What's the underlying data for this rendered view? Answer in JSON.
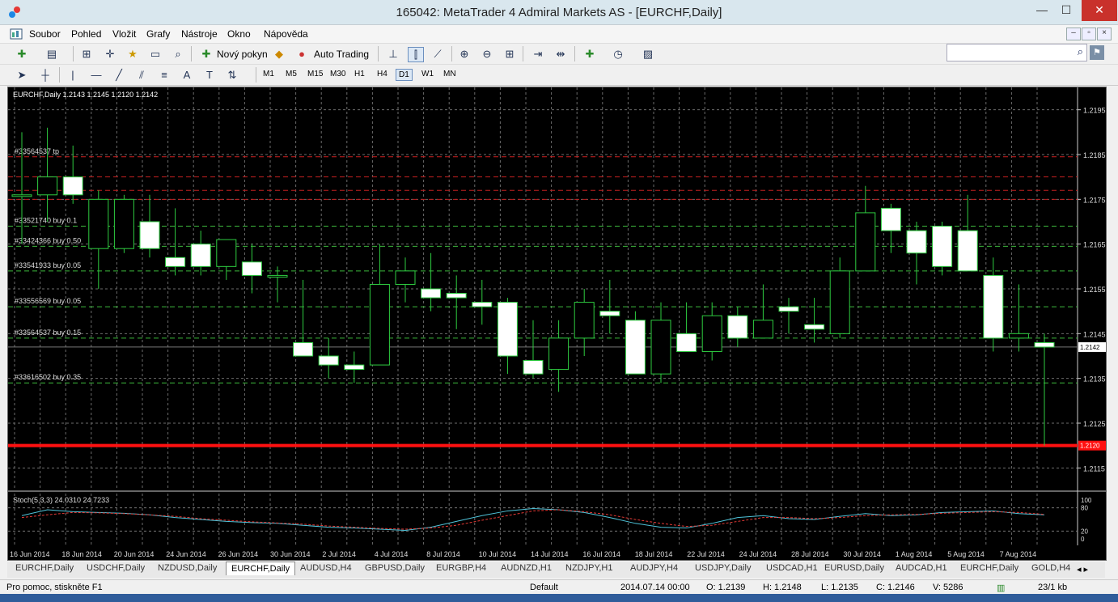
{
  "window": {
    "title": "165042: MetaTrader 4 Admiral Markets AS - [EURCHF,Daily]",
    "min_glyph": "—",
    "max_glyph": "☐",
    "close_glyph": "✕"
  },
  "menu": [
    "Soubor",
    "Pohled",
    "Vložit",
    "Grafy",
    "Nástroje",
    "Okno",
    "Nápověda"
  ],
  "toolbar": {
    "new_order_label": "Nový pokyn",
    "auto_trading_label": "Auto Trading"
  },
  "timeframes": [
    "M1",
    "M5",
    "M15",
    "M30",
    "H1",
    "H4",
    "D1",
    "W1",
    "MN"
  ],
  "active_timeframe": "D1",
  "chart": {
    "header": "EURCHF,Daily  1.2143 1.2145 1.2120 1.2142",
    "price_labels": [
      "1.2195",
      "1.2185",
      "1.2175",
      "1.2165",
      "1.2155",
      "1.2145",
      "1.2135",
      "1.2125",
      "1.2115"
    ],
    "current_price": "1.2142",
    "alert_price": "1.2120",
    "orders": [
      {
        "label": "#33564537 tp",
        "price": 1.21845,
        "color": "#d02020"
      },
      {
        "label": "#33521740 buy 0.1",
        "price": 1.2169,
        "color": "#3db83d"
      },
      {
        "label": "#33424366 buy 0.50",
        "price": 1.21645,
        "color": "#3db83d"
      },
      {
        "label": "#33541933 buy 0.05",
        "price": 1.2159,
        "color": "#3db83d"
      },
      {
        "label": "#33556569 buy 0.05",
        "price": 1.2151,
        "color": "#3db83d"
      },
      {
        "label": "#33564537 buy 0.15",
        "price": 1.2144,
        "color": "#3db83d"
      },
      {
        "label": "#33616502 buy 0.35",
        "price": 1.2134,
        "color": "#3db83d"
      }
    ],
    "stoch_header": "Stoch(5,3,3) 24.0310 24.7233",
    "stoch_levels": [
      "100",
      "80",
      "20",
      "0"
    ],
    "dates": [
      "16 Jun 2014",
      "18 Jun 2014",
      "20 Jun 2014",
      "24 Jun 2014",
      "26 Jun 2014",
      "30 Jun 2014",
      "2 Jul 2014",
      "4 Jul 2014",
      "8 Jul 2014",
      "10 Jul 2014",
      "14 Jul 2014",
      "16 Jul 2014",
      "18 Jul 2014",
      "22 Jul 2014",
      "24 Jul 2014",
      "28 Jul 2014",
      "30 Jul 2014",
      "1 Aug 2014",
      "5 Aug 2014",
      "7 Aug 2014"
    ]
  },
  "chart_data": {
    "type": "candlestick",
    "title": "EURCHF,Daily",
    "ylim": [
      1.211,
      1.22
    ],
    "candles": [
      {
        "o": 1.2176,
        "h": 1.219,
        "l": 1.2165,
        "c": 1.2176
      },
      {
        "o": 1.2176,
        "h": 1.2191,
        "l": 1.217,
        "c": 1.218
      },
      {
        "o": 1.218,
        "h": 1.2187,
        "l": 1.2174,
        "c": 1.2176
      },
      {
        "o": 1.2164,
        "h": 1.2177,
        "l": 1.2155,
        "c": 1.2175
      },
      {
        "o": 1.2164,
        "h": 1.2176,
        "l": 1.2163,
        "c": 1.2175
      },
      {
        "o": 1.217,
        "h": 1.2176,
        "l": 1.2162,
        "c": 1.2164
      },
      {
        "o": 1.2162,
        "h": 1.2173,
        "l": 1.2158,
        "c": 1.216
      },
      {
        "o": 1.2165,
        "h": 1.2168,
        "l": 1.2158,
        "c": 1.216
      },
      {
        "o": 1.216,
        "h": 1.2166,
        "l": 1.2157,
        "c": 1.2166
      },
      {
        "o": 1.2161,
        "h": 1.2165,
        "l": 1.2154,
        "c": 1.2158
      },
      {
        "o": 1.2158,
        "h": 1.216,
        "l": 1.2152,
        "c": 1.2158
      },
      {
        "o": 1.2143,
        "h": 1.2157,
        "l": 1.214,
        "c": 1.214
      },
      {
        "o": 1.214,
        "h": 1.2144,
        "l": 1.2135,
        "c": 1.2138
      },
      {
        "o": 1.2138,
        "h": 1.2141,
        "l": 1.2134,
        "c": 1.2137
      },
      {
        "o": 1.2138,
        "h": 1.2165,
        "l": 1.2138,
        "c": 1.2156
      },
      {
        "o": 1.2156,
        "h": 1.2162,
        "l": 1.2152,
        "c": 1.2159
      },
      {
        "o": 1.2155,
        "h": 1.2163,
        "l": 1.215,
        "c": 1.2153
      },
      {
        "o": 1.2154,
        "h": 1.2158,
        "l": 1.2146,
        "c": 1.2153
      },
      {
        "o": 1.2152,
        "h": 1.2157,
        "l": 1.2147,
        "c": 1.2151
      },
      {
        "o": 1.2152,
        "h": 1.2153,
        "l": 1.2136,
        "c": 1.214
      },
      {
        "o": 1.2139,
        "h": 1.2148,
        "l": 1.2135,
        "c": 1.2136
      },
      {
        "o": 1.2137,
        "h": 1.2148,
        "l": 1.2132,
        "c": 1.2144
      },
      {
        "o": 1.2144,
        "h": 1.2155,
        "l": 1.214,
        "c": 1.2152
      },
      {
        "o": 1.215,
        "h": 1.2157,
        "l": 1.2145,
        "c": 1.2149
      },
      {
        "o": 1.2148,
        "h": 1.215,
        "l": 1.2136,
        "c": 1.2136
      },
      {
        "o": 1.2136,
        "h": 1.2152,
        "l": 1.2134,
        "c": 1.2148
      },
      {
        "o": 1.2145,
        "h": 1.2152,
        "l": 1.2141,
        "c": 1.2141
      },
      {
        "o": 1.2141,
        "h": 1.2152,
        "l": 1.2139,
        "c": 1.2149
      },
      {
        "o": 1.2149,
        "h": 1.2151,
        "l": 1.2142,
        "c": 1.2144
      },
      {
        "o": 1.2144,
        "h": 1.2156,
        "l": 1.2144,
        "c": 1.2148
      },
      {
        "o": 1.2151,
        "h": 1.2153,
        "l": 1.2145,
        "c": 1.215
      },
      {
        "o": 1.2147,
        "h": 1.2153,
        "l": 1.2143,
        "c": 1.2146
      },
      {
        "o": 1.2145,
        "h": 1.2162,
        "l": 1.2144,
        "c": 1.2159
      },
      {
        "o": 1.2159,
        "h": 1.2178,
        "l": 1.2159,
        "c": 1.2172
      },
      {
        "o": 1.2173,
        "h": 1.2174,
        "l": 1.2163,
        "c": 1.2168
      },
      {
        "o": 1.2168,
        "h": 1.217,
        "l": 1.2156,
        "c": 1.2163
      },
      {
        "o": 1.2169,
        "h": 1.217,
        "l": 1.2158,
        "c": 1.216
      },
      {
        "o": 1.2168,
        "h": 1.2176,
        "l": 1.2159,
        "c": 1.2159
      },
      {
        "o": 1.2158,
        "h": 1.2162,
        "l": 1.2141,
        "c": 1.2144
      },
      {
        "o": 1.2144,
        "h": 1.2156,
        "l": 1.2141,
        "c": 1.2145
      },
      {
        "o": 1.2143,
        "h": 1.2145,
        "l": 1.212,
        "c": 1.2142
      }
    ],
    "stoch_main": [
      60,
      75,
      70,
      68,
      66,
      62,
      55,
      50,
      45,
      42,
      40,
      35,
      30,
      28,
      25,
      22,
      30,
      45,
      60,
      72,
      78,
      75,
      68,
      55,
      40,
      30,
      28,
      40,
      55,
      60,
      52,
      50,
      58,
      65,
      60,
      62,
      68,
      70,
      72,
      65,
      62
    ],
    "stoch_signal": [
      55,
      62,
      68,
      67,
      65,
      62,
      58,
      52,
      48,
      44,
      41,
      38,
      33,
      30,
      27,
      25,
      28,
      35,
      48,
      60,
      72,
      75,
      70,
      62,
      50,
      40,
      32,
      35,
      45,
      55,
      55,
      52,
      55,
      60,
      62,
      63,
      66,
      68,
      70,
      68,
      63
    ]
  },
  "symbol_tabs": [
    "EURCHF,Daily",
    "USDCHF,Daily",
    "NZDUSD,Daily",
    "EURCHF,Daily",
    "AUDUSD,H4",
    "GBPUSD,Daily",
    "EURGBP,H4",
    "AUDNZD,H1",
    "NZDJPY,H1",
    "AUDJPY,H4",
    "USDJPY,Daily",
    "USDCAD,H1",
    "EURUSD,Daily",
    "AUDCAD,H1",
    "EURCHF,Daily",
    "GOLD,H4"
  ],
  "active_tab_index": 3,
  "status": {
    "help": "Pro pomoc, stiskněte F1",
    "profile": "Default",
    "datetime": "2014.07.14 00:00",
    "open": "O: 1.2139",
    "high": "H: 1.2148",
    "low": "L: 1.2135",
    "close": "C: 1.2146",
    "volume": "V: 5286",
    "traffic": "23/1 kb"
  }
}
